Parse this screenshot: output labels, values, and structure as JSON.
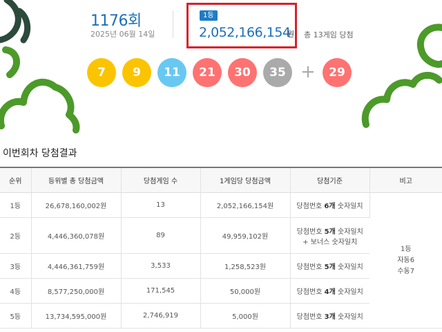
{
  "colors": {
    "accent_blue": "#1d6fb8",
    "highlight_red": "#d9202a",
    "ball_yellow": "#fbc400",
    "ball_blue": "#69c8f2",
    "ball_red": "#ff7272",
    "ball_gray": "#aaaaaa",
    "decor_green": "#4c9a2a",
    "decor_dark": "#2c4a3c"
  },
  "draw": {
    "round_number": "1176",
    "round_suffix": "회",
    "date": "2025년 06월 14일",
    "first_prize_badge": "1등",
    "first_prize_amount": "2,052,166,154",
    "currency_unit": "원",
    "total_winners_text": "총 13게임 당첨"
  },
  "balls": [
    {
      "number": "7",
      "color": "yellow"
    },
    {
      "number": "9",
      "color": "yellow"
    },
    {
      "number": "11",
      "color": "blue"
    },
    {
      "number": "21",
      "color": "red"
    },
    {
      "number": "30",
      "color": "red"
    },
    {
      "number": "35",
      "color": "gray"
    }
  ],
  "plus_symbol": "+",
  "bonus_ball": {
    "number": "29",
    "color": "red"
  },
  "results_section": {
    "title": "이번회차 당첨결과",
    "columns": [
      "순위",
      "등위별 총 당첨금액",
      "당첨게임 수",
      "1게임당 당첨금액",
      "당첨기준",
      "비고"
    ],
    "rows": [
      {
        "rank": "1등",
        "total": "26,678,160,002원",
        "games": "13",
        "per_game": "2,052,166,154원",
        "crit_pre": "당첨번호 ",
        "crit_num": "6개",
        "crit_post": " 숫자일치",
        "crit_extra": ""
      },
      {
        "rank": "2등",
        "total": "4,446,360,078원",
        "games": "89",
        "per_game": "49,959,102원",
        "crit_pre": "당첨번호 ",
        "crit_num": "5개",
        "crit_post": " 숫자일치",
        "crit_extra": "+ 보너스 숫자일치"
      },
      {
        "rank": "3등",
        "total": "4,446,361,759원",
        "games": "3,533",
        "per_game": "1,258,523원",
        "crit_pre": "당첨번호 ",
        "crit_num": "5개",
        "crit_post": " 숫자일치",
        "crit_extra": ""
      },
      {
        "rank": "4등",
        "total": "8,577,250,000원",
        "games": "171,545",
        "per_game": "50,000원",
        "crit_pre": "당첨번호 ",
        "crit_num": "4개",
        "crit_post": " 숫자일치",
        "crit_extra": ""
      },
      {
        "rank": "5등",
        "total": "13,734,595,000원",
        "games": "2,746,919",
        "per_game": "5,000원",
        "crit_pre": "당첨번호 ",
        "crit_num": "3개",
        "crit_post": " 숫자일치",
        "crit_extra": ""
      }
    ],
    "note": {
      "line1": "1등",
      "line2": "자동6",
      "line3": "수동7"
    }
  }
}
